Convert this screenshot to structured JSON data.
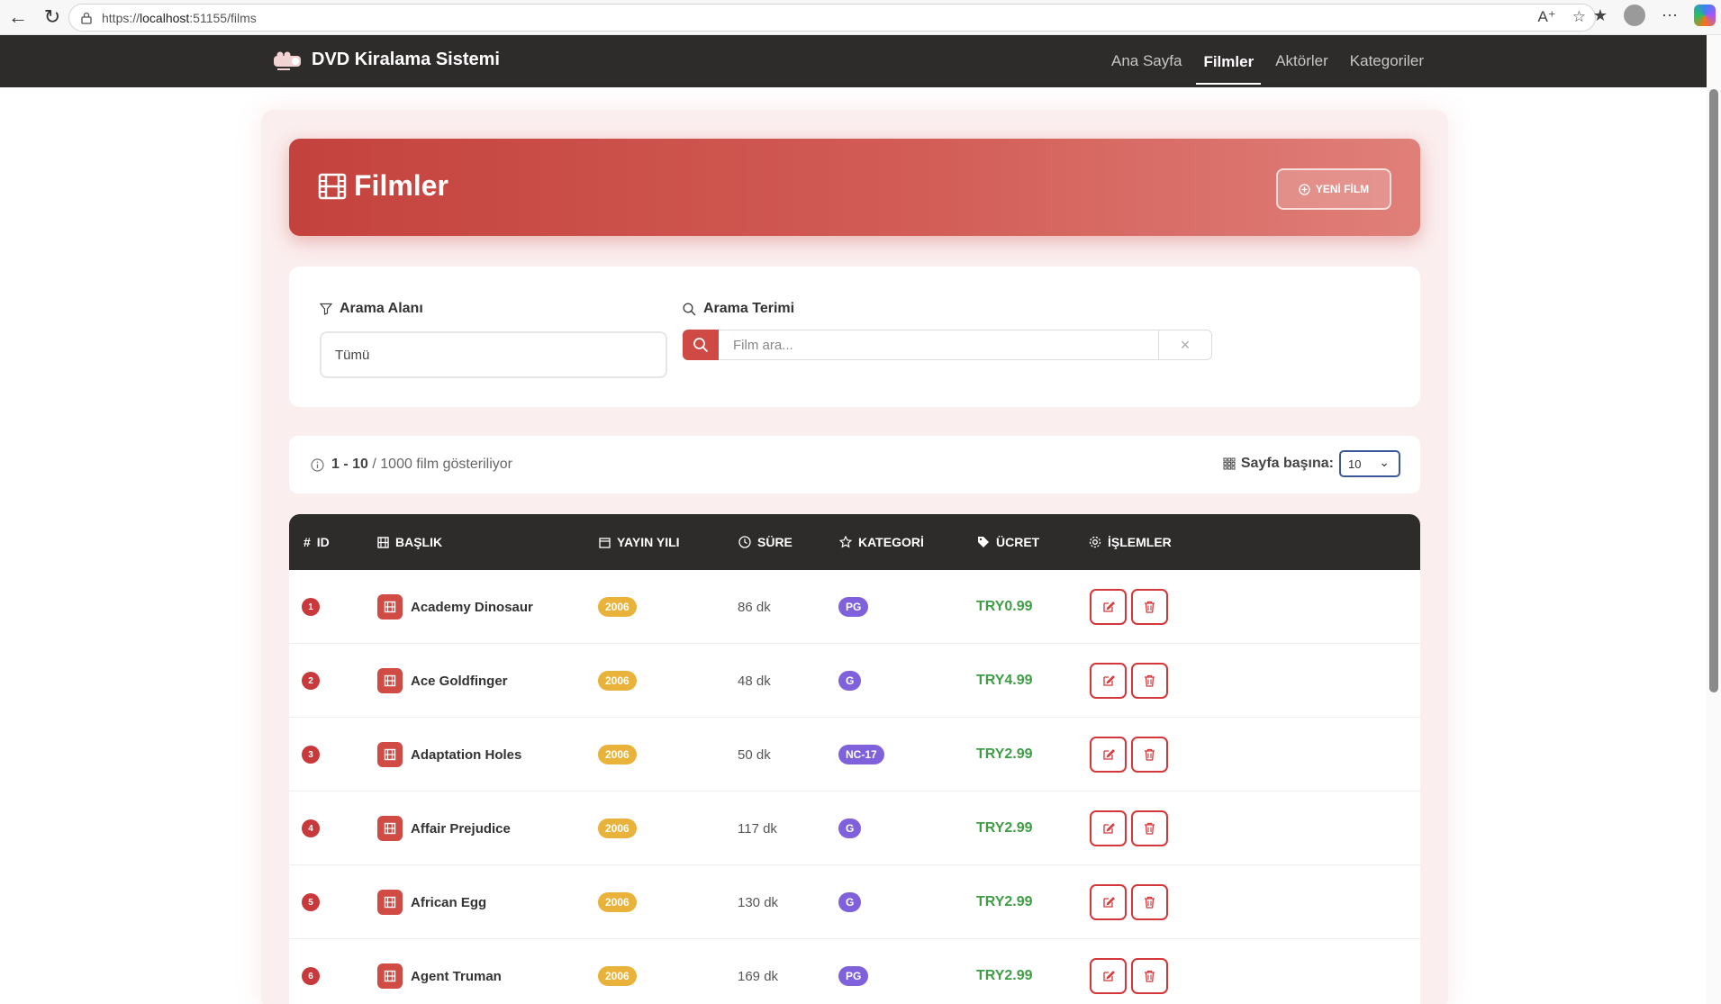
{
  "browser": {
    "url_prefix": "https://",
    "url_host": "localhost",
    "url_rest": ":51155/films"
  },
  "navbar": {
    "brand": "DVD Kiralama Sistemi",
    "links": [
      "Ana Sayfa",
      "Filmler",
      "Aktörler",
      "Kategoriler"
    ],
    "active": "Filmler"
  },
  "hero": {
    "title": "Filmler",
    "new_button": "YENİ FİLM"
  },
  "filter": {
    "field_label": "Arama Alanı",
    "field_value": "Tümü",
    "term_label": "Arama Terimi",
    "search_placeholder": "Film ara..."
  },
  "info": {
    "range": "1 - 10",
    "rest": "/ 1000 film gösteriliyor",
    "per_page_label": "Sayfa başına:",
    "per_page_value": "10"
  },
  "table": {
    "headers": {
      "id": "ID",
      "title": "BAŞLIK",
      "year": "YAYIN YILI",
      "duration": "SÜRE",
      "category": "KATEGORİ",
      "price": "ÜCRET",
      "actions": "İŞLEMLER"
    },
    "rows": [
      {
        "id": "1",
        "title": "Academy Dinosaur",
        "year": "2006",
        "duration": "86 dk",
        "rating": "PG",
        "price": "TRY0.99"
      },
      {
        "id": "2",
        "title": "Ace Goldfinger",
        "year": "2006",
        "duration": "48 dk",
        "rating": "G",
        "price": "TRY4.99"
      },
      {
        "id": "3",
        "title": "Adaptation Holes",
        "year": "2006",
        "duration": "50 dk",
        "rating": "NC-17",
        "price": "TRY2.99"
      },
      {
        "id": "4",
        "title": "Affair Prejudice",
        "year": "2006",
        "duration": "117 dk",
        "rating": "G",
        "price": "TRY2.99"
      },
      {
        "id": "5",
        "title": "African Egg",
        "year": "2006",
        "duration": "130 dk",
        "rating": "G",
        "price": "TRY2.99"
      },
      {
        "id": "6",
        "title": "Agent Truman",
        "year": "2006",
        "duration": "169 dk",
        "rating": "PG",
        "price": "TRY2.99"
      }
    ]
  },
  "colors": {
    "accent": "#cf4a44",
    "navbar": "#2e2b2b",
    "year_badge": "#e9b23a",
    "rating_badge": "#7f62db",
    "price": "#3f9d46"
  }
}
